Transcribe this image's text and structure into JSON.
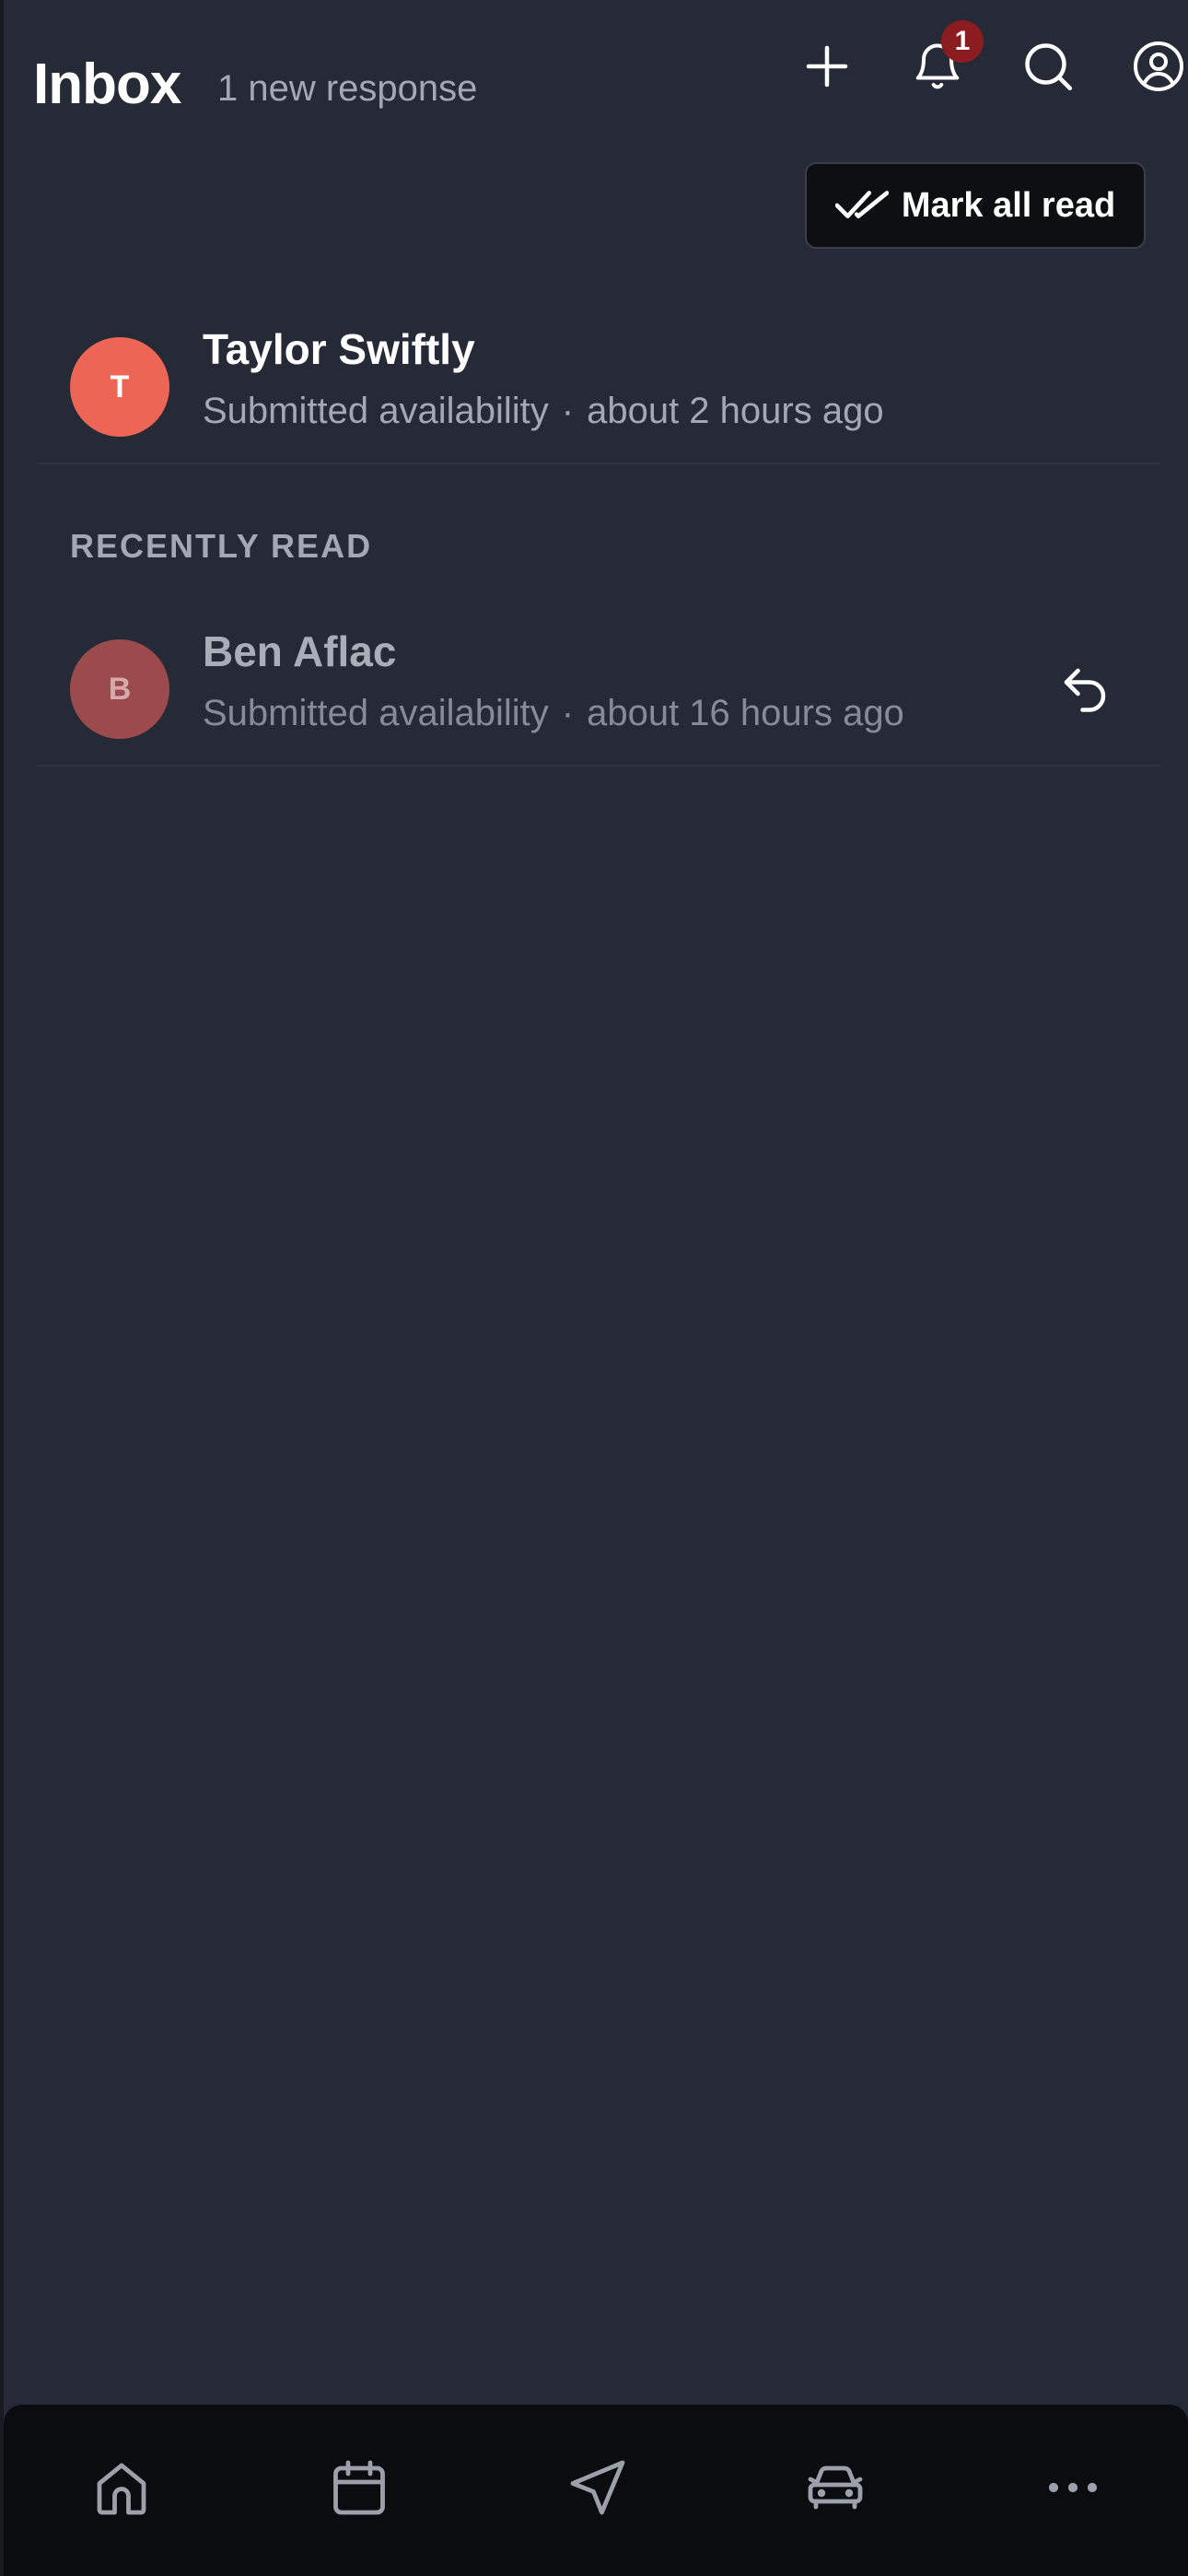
{
  "header": {
    "title": "Inbox",
    "subtitle": "1 new response",
    "icons": [
      "plus-icon",
      "bell-icon",
      "search-icon",
      "user-circle-icon"
    ],
    "notification_count": "1"
  },
  "mark_all_read_label": "Mark all read",
  "unread": [
    {
      "initial": "T",
      "name": "Taylor Swiftly",
      "action": "Submitted availability",
      "separator": "·",
      "time": "about 2 hours ago",
      "avatar_color": "#ec6555"
    }
  ],
  "recently_read": {
    "label": "RECENTLY READ",
    "items": [
      {
        "initial": "B",
        "name": "Ben Aflac",
        "action": "Submitted availability",
        "separator": "·",
        "time": "about 16 hours ago",
        "avatar_color": "#9b4a4d"
      }
    ]
  },
  "bottom_nav": [
    "home-icon",
    "calendar-icon",
    "navigation-icon",
    "car-icon",
    "more-icon"
  ],
  "colors": {
    "background": "#262a36",
    "nav_background": "#0b0c10",
    "badge": "#8b1c1f",
    "muted_text": "#a3a8b4"
  }
}
